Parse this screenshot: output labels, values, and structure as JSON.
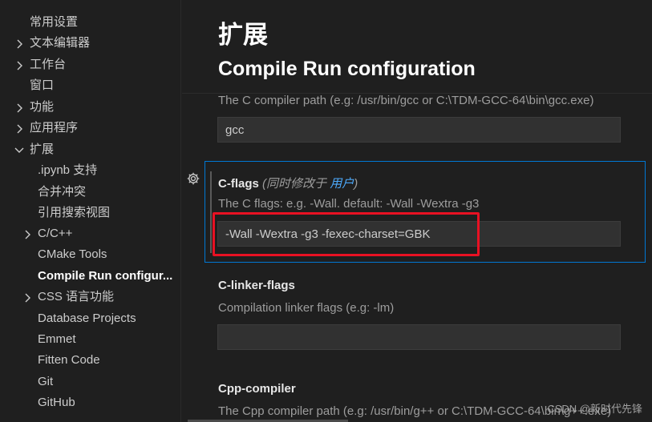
{
  "sidebar": {
    "items": [
      {
        "label": "常用设置"
      },
      {
        "label": "文本编辑器"
      },
      {
        "label": "工作台"
      },
      {
        "label": "窗口"
      },
      {
        "label": "功能"
      },
      {
        "label": "应用程序"
      },
      {
        "label": "扩展"
      },
      {
        "label": ".ipynb 支持"
      },
      {
        "label": "合并冲突"
      },
      {
        "label": "引用搜索视图"
      },
      {
        "label": "C/C++"
      },
      {
        "label": "CMake Tools"
      },
      {
        "label": "Compile Run configur..."
      },
      {
        "label": "CSS 语言功能"
      },
      {
        "label": "Database Projects"
      },
      {
        "label": "Emmet"
      },
      {
        "label": "Fitten Code"
      },
      {
        "label": "Git"
      },
      {
        "label": "GitHub"
      }
    ]
  },
  "main": {
    "page_title": "扩展",
    "section_title": "Compile Run configuration",
    "c_compiler": {
      "description": "The C compiler path (e.g: /usr/bin/gcc or C:\\TDM-GCC-64\\bin\\gcc.exe)",
      "value": "gcc"
    },
    "c_flags": {
      "name": "C-flags",
      "modified_prefix": "(同时修改于 ",
      "modified_link": "用户",
      "modified_suffix": ")",
      "description": "The C flags: e.g. -Wall. default: -Wall -Wextra -g3",
      "value": "-Wall -Wextra -g3 -fexec-charset=GBK"
    },
    "c_linker_flags": {
      "name": "C-linker-flags",
      "description": "Compilation linker flags (e.g: -lm)",
      "value": ""
    },
    "cpp_compiler": {
      "name": "Cpp-compiler",
      "description": "The Cpp compiler path (e.g: /usr/bin/g++ or C:\\TDM-GCC-64\\bin\\g++.exe)"
    }
  },
  "watermark": "CSDN @新时代先锋",
  "colors": {
    "background": "#1f1f1f",
    "focus_border": "#0078d4",
    "annotation_red": "#e81123",
    "link": "#4daafc"
  }
}
